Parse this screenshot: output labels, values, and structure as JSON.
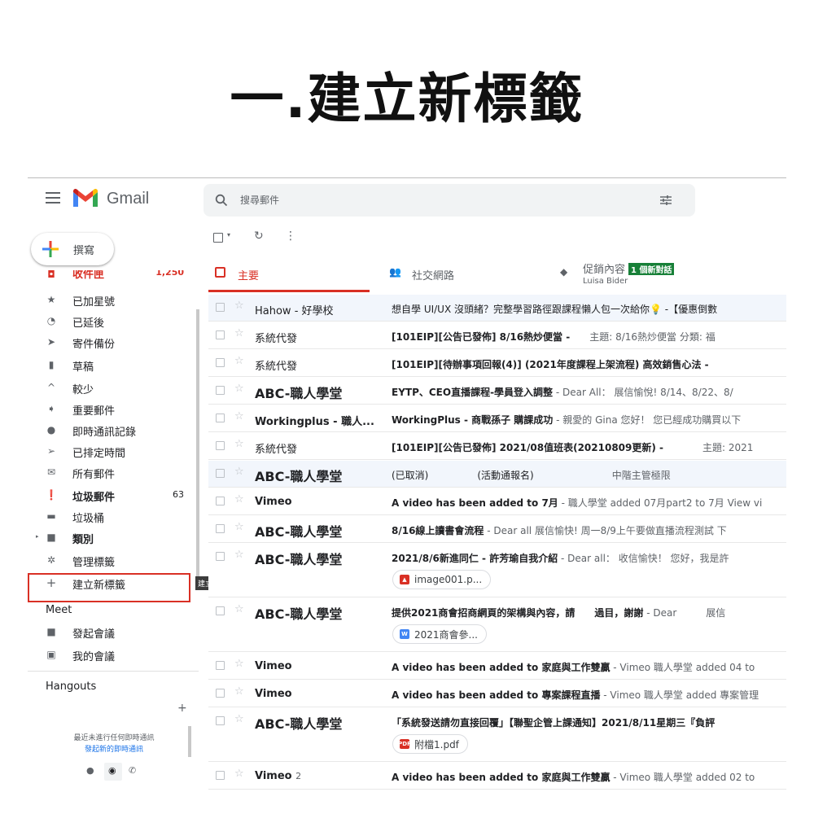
{
  "page": {
    "title": "一.建立新標籤"
  },
  "header": {
    "app_name": "Gmail",
    "search_placeholder": "搜尋郵件"
  },
  "compose": {
    "label": "撰寫"
  },
  "sidebar": {
    "items": [
      {
        "icon": "inbox-icon",
        "label": "收件匣",
        "count": "1,250"
      },
      {
        "icon": "star-icon",
        "label": "已加星號"
      },
      {
        "icon": "clock-icon",
        "label": "已延後"
      },
      {
        "icon": "send-icon",
        "label": "寄件備份"
      },
      {
        "icon": "draft-icon",
        "label": "草稿"
      },
      {
        "icon": "chevron-up-icon",
        "label": "較少"
      },
      {
        "icon": "important-icon",
        "label": "重要郵件"
      },
      {
        "icon": "chat-icon",
        "label": "即時通訊記錄"
      },
      {
        "icon": "scheduled-icon",
        "label": "已排定時間"
      },
      {
        "icon": "all-mail-icon",
        "label": "所有郵件"
      },
      {
        "icon": "spam-icon",
        "label": "垃圾郵件",
        "count": "63"
      },
      {
        "icon": "trash-icon",
        "label": "垃圾桶"
      },
      {
        "icon": "label-icon",
        "label": "類別"
      },
      {
        "icon": "gear-icon",
        "label": "管理標籤"
      },
      {
        "icon": "plus-icon",
        "label": "建立新標籤"
      }
    ],
    "tooltip": "建立新標籤",
    "meet": {
      "title": "Meet",
      "items": [
        {
          "icon": "video-icon",
          "label": "發起會議"
        },
        {
          "icon": "calendar-icon",
          "label": "我的會議"
        }
      ]
    },
    "hangouts": {
      "title": "Hangouts",
      "note": "最近未進行任何即時通訊",
      "link": "發起新的即時通訊"
    }
  },
  "tabs": [
    {
      "label": "主要"
    },
    {
      "label": "社交網路"
    },
    {
      "label": "促銷內容",
      "badge": "1 個新對話",
      "sub": "Luisa Bider"
    }
  ],
  "emails": [
    {
      "sender": "Hahow - 好學校",
      "subject": "想自學 UI/UX 沒頭緒？完整學習路徑跟課程懶人包一次給你💡 -【優惠倒數",
      "snippet": "",
      "read": true,
      "style": "normal"
    },
    {
      "sender": "系統代發",
      "subject": "[101EIP][公告已發佈] 8/16熱炒便當 -",
      "snippet": "　　主題: 8/16熱炒便當 分類: 福",
      "read": false,
      "style": "normal"
    },
    {
      "sender": "系統代發",
      "subject": "[101EIP][待辦事項回報(4)] (2021年度課程上架流程) 高效銷售心法 -",
      "snippet": "",
      "read": false,
      "style": "normal"
    },
    {
      "sender": "ABC-職人學堂",
      "subject": "EYTP、CEO直播課程-學員登入調整",
      "snippet": " - Dear All： 展信愉悅! 8/14、8/22、8/",
      "read": false,
      "style": "big"
    },
    {
      "sender": "Workingplus - 職人...",
      "subject": "WorkingPlus - 商戰孫子 購課成功",
      "snippet": " - 親愛的 Gina 您好！ 您已經成功購買以下",
      "read": false,
      "style": "bold"
    },
    {
      "sender": "系統代發",
      "subject": "[101EIP][公告已發佈] 2021/08值班表(20210809更新) -",
      "snippet": "　　　　主題: 2021",
      "read": false,
      "style": "normal"
    },
    {
      "sender": "ABC-職人學堂",
      "subject": "(已取消)　　　　　(活動通報名)",
      "snippet": "　　　　　　　　中階主管極限",
      "read": true,
      "style": "big"
    },
    {
      "sender": "Vimeo",
      "subject": "A video has been added to 7月",
      "snippet": " - 職人學堂 added 07月part2 to 7月 View vi",
      "read": false,
      "style": "bold"
    },
    {
      "sender": "ABC-職人學堂",
      "subject": "8/16線上讀書會流程",
      "snippet": " - Dear all 展信愉快! 周一8/9上午要做直播流程測試 下",
      "read": false,
      "style": "big"
    },
    {
      "sender": "ABC-職人學堂",
      "subject": "2021/8/6新進同仁 - 許芳瑜自我介紹",
      "snippet": " - Dear all： 收信愉快！ 您好，我是許",
      "read": false,
      "style": "big",
      "chip": "image001.p...",
      "chip_icon": "image-icon"
    },
    {
      "sender": "ABC-職人學堂",
      "subject": "提供2021商會招商網頁的架構與內容，請　　過目，謝謝",
      "snippet": " - Dear　　　展信",
      "read": false,
      "style": "big",
      "chip": "2021商會參...",
      "chip_icon": "word-icon"
    },
    {
      "sender": "Vimeo",
      "subject": "A video has been added to 家庭與工作雙贏",
      "snippet": " - Vimeo 職人學堂 added 04 to",
      "read": false,
      "style": "bold"
    },
    {
      "sender": "Vimeo",
      "subject": "A video has been added to 專案課程直播",
      "snippet": " - Vimeo 職人學堂 added 專案管理",
      "read": false,
      "style": "bold"
    },
    {
      "sender": "ABC-職人學堂",
      "subject": "「系統發送請勿直接回覆」【聯聖企管上課通知】2021/8/11星期三『負評",
      "snippet": "",
      "read": false,
      "style": "big",
      "chip": "附檔1.pdf",
      "chip_icon": "pdf-icon"
    },
    {
      "sender": "Vimeo",
      "sender_count": "2",
      "subject": "A video has been added to 家庭與工作雙贏",
      "snippet": " - Vimeo 職人學堂 added 02 to",
      "read": false,
      "style": "bold"
    }
  ],
  "colors": {
    "accent": "#d93025",
    "badge": "#188038",
    "highlight_box": "#d93025"
  }
}
